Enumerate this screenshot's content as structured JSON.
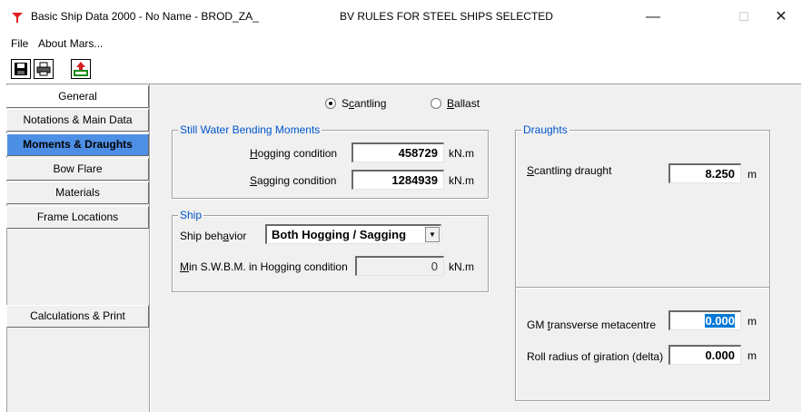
{
  "window": {
    "title": "Basic Ship Data 2000 - No Name - BROD_ZA_",
    "rules": "BV RULES FOR STEEL SHIPS SELECTED",
    "minimize": "—",
    "maximize": "☐",
    "close": "✕"
  },
  "menu": {
    "file": "File",
    "about": "About Mars..."
  },
  "nav": {
    "general": "General",
    "notations": "Notations & Main Data",
    "moments": "Moments & Draughts",
    "bow_flare": "Bow Flare",
    "materials": "Materials",
    "frame_locations": "Frame Locations",
    "calculations": "Calculations & Print"
  },
  "mode": {
    "scantling_pre": "S",
    "scantling_u": "c",
    "scantling_post": "antling",
    "ballast_u": "B",
    "ballast_post": "allast",
    "selected": "Scantling"
  },
  "swbm": {
    "title": "Still Water Bending Moments",
    "hogging_u": "H",
    "hogging_post": "ogging condition",
    "hogging_value": "458729",
    "sagging_u": "S",
    "sagging_post": "agging  condition",
    "sagging_value": "1284939",
    "unit": "kN.m"
  },
  "ship": {
    "title": "Ship",
    "behavior_pre": "Ship beh",
    "behavior_u": "a",
    "behavior_post": "vior",
    "behavior_value": "Both Hogging / Sagging",
    "min_u": "M",
    "min_post": "in S.W.B.M. in Hogging condition",
    "min_value": "0",
    "unit": "kN.m"
  },
  "draughts": {
    "title": "Draughts",
    "scantling_u": "S",
    "scantling_post": "cantling draught",
    "scantling_value": "8.250",
    "gm_pre": "GM ",
    "gm_u": "t",
    "gm_post": "ransverse metacentre",
    "gm_value": "0.000",
    "roll_label": "Roll radius of giration (delta)",
    "roll_value": "0.000",
    "unit": "m"
  },
  "colors": {
    "accent": "#4e8fe6",
    "group_title": "#0055cc",
    "selection": "#0078d7"
  }
}
